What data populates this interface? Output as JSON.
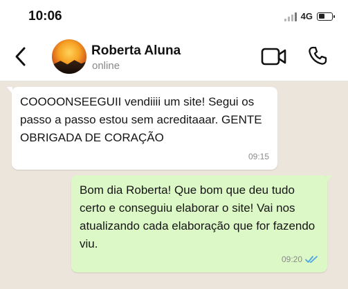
{
  "status_bar": {
    "time": "10:06",
    "network": "4G"
  },
  "header": {
    "contact_name": "Roberta Aluna",
    "contact_status": "online"
  },
  "messages": [
    {
      "direction": "incoming",
      "text": "COOOONSEEGUII vendiiii um site! Segui os passo a passo estou sem acreditaaar. GENTE OBRIGADA DE CORAÇÃO",
      "time": "09:15"
    },
    {
      "direction": "outgoing",
      "text": "Bom dia Roberta! Que bom que deu tudo certo e conseguiu elaborar o site! Vai nos atualizando cada elaboração que for fazendo viu.",
      "time": "09:20",
      "read": true
    }
  ],
  "colors": {
    "outgoing_bubble": "#dcf8c6",
    "incoming_bubble": "#ffffff",
    "read_ticks": "#4fa3e0",
    "chat_background": "#ece5dc"
  },
  "icons": [
    "back-arrow-icon",
    "video-call-icon",
    "phone-icon",
    "double-check-icon",
    "battery-icon",
    "signal-icon"
  ]
}
